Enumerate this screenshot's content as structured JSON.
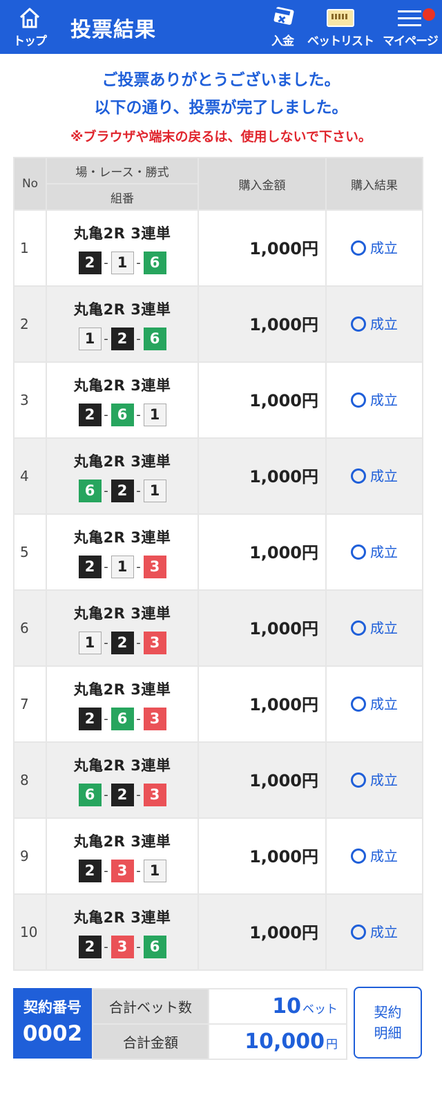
{
  "header": {
    "home_label": "トップ",
    "title": "投票結果",
    "deposit_label": "入金",
    "betlist_label": "ベットリスト",
    "mypage_label": "マイページ"
  },
  "messages": {
    "line1": "ご投票ありがとうございました。",
    "line2": "以下の通り、投票が完了しました。",
    "warning": "※ブラウザや端末の戻るは、使用しないで下さい。"
  },
  "table": {
    "headers": {
      "no": "No",
      "race": "場・レース・勝式",
      "combo": "組番",
      "amount": "購入金額",
      "result": "購入結果"
    },
    "rows": [
      {
        "no": "1",
        "race": "丸亀2R 3連単",
        "combo": [
          "2",
          "1",
          "6"
        ],
        "amount": "1,000円",
        "result": "成立"
      },
      {
        "no": "2",
        "race": "丸亀2R 3連単",
        "combo": [
          "1",
          "2",
          "6"
        ],
        "amount": "1,000円",
        "result": "成立"
      },
      {
        "no": "3",
        "race": "丸亀2R 3連単",
        "combo": [
          "2",
          "6",
          "1"
        ],
        "amount": "1,000円",
        "result": "成立"
      },
      {
        "no": "4",
        "race": "丸亀2R 3連単",
        "combo": [
          "6",
          "2",
          "1"
        ],
        "amount": "1,000円",
        "result": "成立"
      },
      {
        "no": "5",
        "race": "丸亀2R 3連単",
        "combo": [
          "2",
          "1",
          "3"
        ],
        "amount": "1,000円",
        "result": "成立"
      },
      {
        "no": "6",
        "race": "丸亀2R 3連単",
        "combo": [
          "1",
          "2",
          "3"
        ],
        "amount": "1,000円",
        "result": "成立"
      },
      {
        "no": "7",
        "race": "丸亀2R 3連単",
        "combo": [
          "2",
          "6",
          "3"
        ],
        "amount": "1,000円",
        "result": "成立"
      },
      {
        "no": "8",
        "race": "丸亀2R 3連単",
        "combo": [
          "6",
          "2",
          "3"
        ],
        "amount": "1,000円",
        "result": "成立"
      },
      {
        "no": "9",
        "race": "丸亀2R 3連単",
        "combo": [
          "2",
          "3",
          "1"
        ],
        "amount": "1,000円",
        "result": "成立"
      },
      {
        "no": "10",
        "race": "丸亀2R 3連単",
        "combo": [
          "2",
          "3",
          "6"
        ],
        "amount": "1,000円",
        "result": "成立"
      }
    ]
  },
  "summary": {
    "contract_label": "契約番号",
    "contract_no": "0002",
    "bet_count_label": "合計ベット数",
    "bet_count": "10",
    "bet_count_unit": "ベット",
    "total_label": "合計金額",
    "total": "10,000",
    "total_unit": "円",
    "detail_line1": "契約",
    "detail_line2": "明細"
  },
  "colors": {
    "primary": "#1f5fd9",
    "warning": "#e0262e",
    "boat_1": "#f3f3f3",
    "boat_2": "#222222",
    "boat_3": "#ea5257",
    "boat_6": "#27a55e"
  },
  "icons": {
    "home": "home-icon",
    "deposit": "deposit-card-icon",
    "betlist": "ticket-icon",
    "mypage": "hamburger-menu-icon",
    "result_ok": "circle-ok-icon"
  }
}
